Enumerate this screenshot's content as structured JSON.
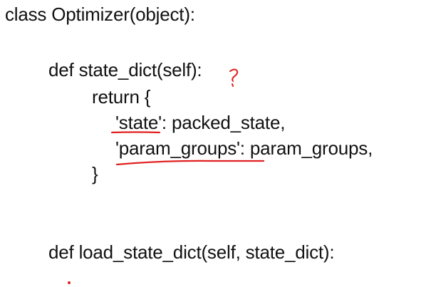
{
  "code": {
    "class_line": "class Optimizer(object):",
    "state_dict_def": "def state_dict(self):",
    "return_line": "return {",
    "state_key": "'state'",
    "state_value": ": packed_state,",
    "param_groups_key": "'param_groups'",
    "param_groups_value": ": param_groups,",
    "closing_brace": "}",
    "load_state_dict_def": "def load_state_dict(self, state_dict):"
  },
  "annotations": {
    "ink_color": "#e02020"
  }
}
